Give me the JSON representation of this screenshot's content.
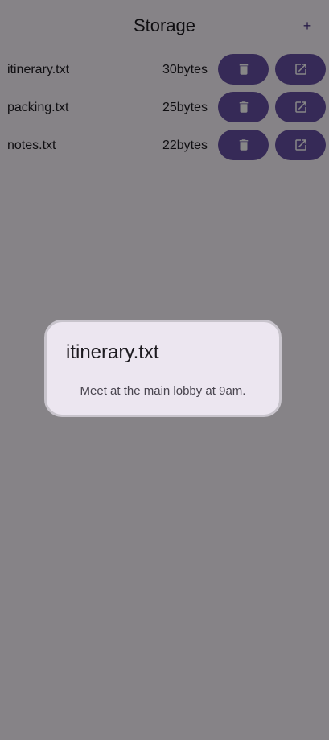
{
  "app_bar": {
    "title": "Storage",
    "add_label": "+"
  },
  "files": [
    {
      "name": "itinerary.txt",
      "size": "30bytes"
    },
    {
      "name": "packing.txt",
      "size": "25bytes"
    },
    {
      "name": "notes.txt",
      "size": "22bytes"
    }
  ],
  "icons": {
    "delete": "trash-icon",
    "open": "open-in-new-icon"
  },
  "dialog": {
    "title": "itinerary.txt",
    "body": "Meet at the main lobby at 9am."
  },
  "colors": {
    "primary": "#6750a4",
    "background": "#fef7ff",
    "dialog_surface": "#ece6f0",
    "scrim": "#000000"
  }
}
